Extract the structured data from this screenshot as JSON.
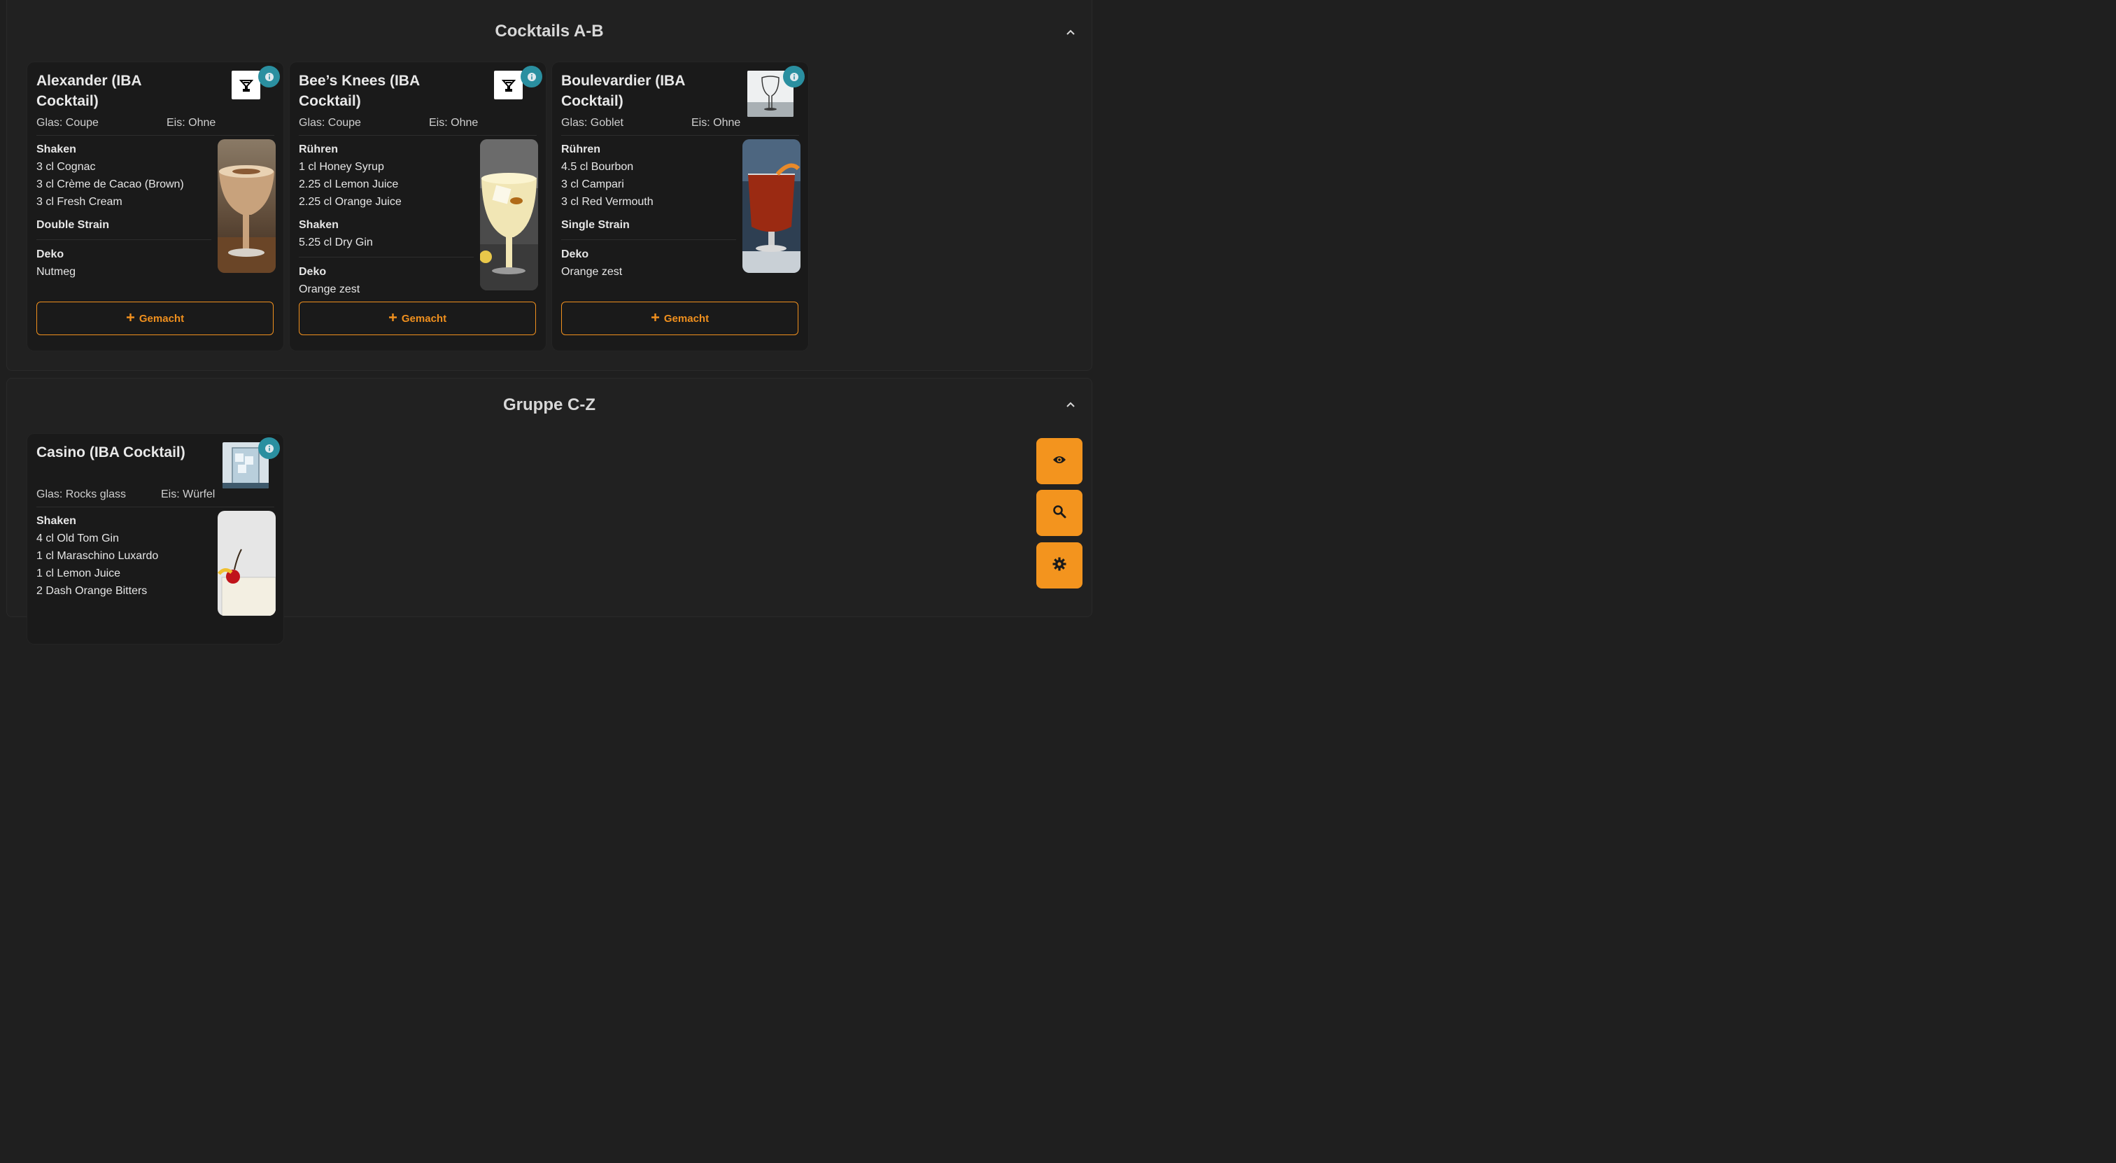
{
  "sections": [
    {
      "title": "Cocktails A-B",
      "cards": [
        {
          "name": "Alexander (IBA Cocktail)",
          "glass": "Glas: Coupe",
          "ice": "Eis: Ohne",
          "steps": [
            {
              "heading": "Shaken",
              "items": [
                "3 cl Cognac",
                "3 cl Crème de Cacao (Brown)",
                "3 cl Fresh Cream"
              ]
            },
            {
              "heading": "Double Strain",
              "items": []
            }
          ],
          "deco_heading": "Deko",
          "deco": "Nutmeg",
          "button": "Gemacht"
        },
        {
          "name": "Bee’s Knees (IBA Cocktail)",
          "glass": "Glas: Coupe",
          "ice": "Eis: Ohne",
          "steps": [
            {
              "heading": "Rühren",
              "items": [
                "1 cl Honey Syrup",
                "2.25 cl Lemon Juice",
                "2.25 cl Orange Juice"
              ]
            },
            {
              "heading": "Shaken",
              "items": [
                "5.25 cl Dry Gin"
              ]
            }
          ],
          "deco_heading": "Deko",
          "deco": "Orange zest",
          "button": "Gemacht"
        },
        {
          "name": "Boulevardier (IBA Cocktail)",
          "glass": "Glas: Goblet",
          "ice": "Eis: Ohne",
          "steps": [
            {
              "heading": "Rühren",
              "items": [
                "4.5 cl Bourbon",
                "3 cl Campari",
                "3 cl Red Vermouth"
              ]
            },
            {
              "heading": "Single Strain",
              "items": []
            }
          ],
          "deco_heading": "Deko",
          "deco": "Orange zest",
          "button": "Gemacht"
        }
      ]
    },
    {
      "title": "Gruppe C-Z",
      "cards": [
        {
          "name": "Casino (IBA Cocktail)",
          "glass": "Glas: Rocks glass",
          "ice": "Eis: Würfel",
          "steps": [
            {
              "heading": "Shaken",
              "items": [
                "4 cl Old Tom Gin",
                "1 cl Maraschino Luxardo",
                "1 cl Lemon Juice",
                "2 Dash Orange Bitters"
              ]
            }
          ]
        }
      ]
    }
  ],
  "fabs": [
    "eye-icon",
    "search-icon",
    "gear-icon"
  ],
  "colors": {
    "accent": "#f3941e",
    "info": "#2a8fa0",
    "background": "#1f1f1f",
    "card": "#1a1a1a"
  }
}
